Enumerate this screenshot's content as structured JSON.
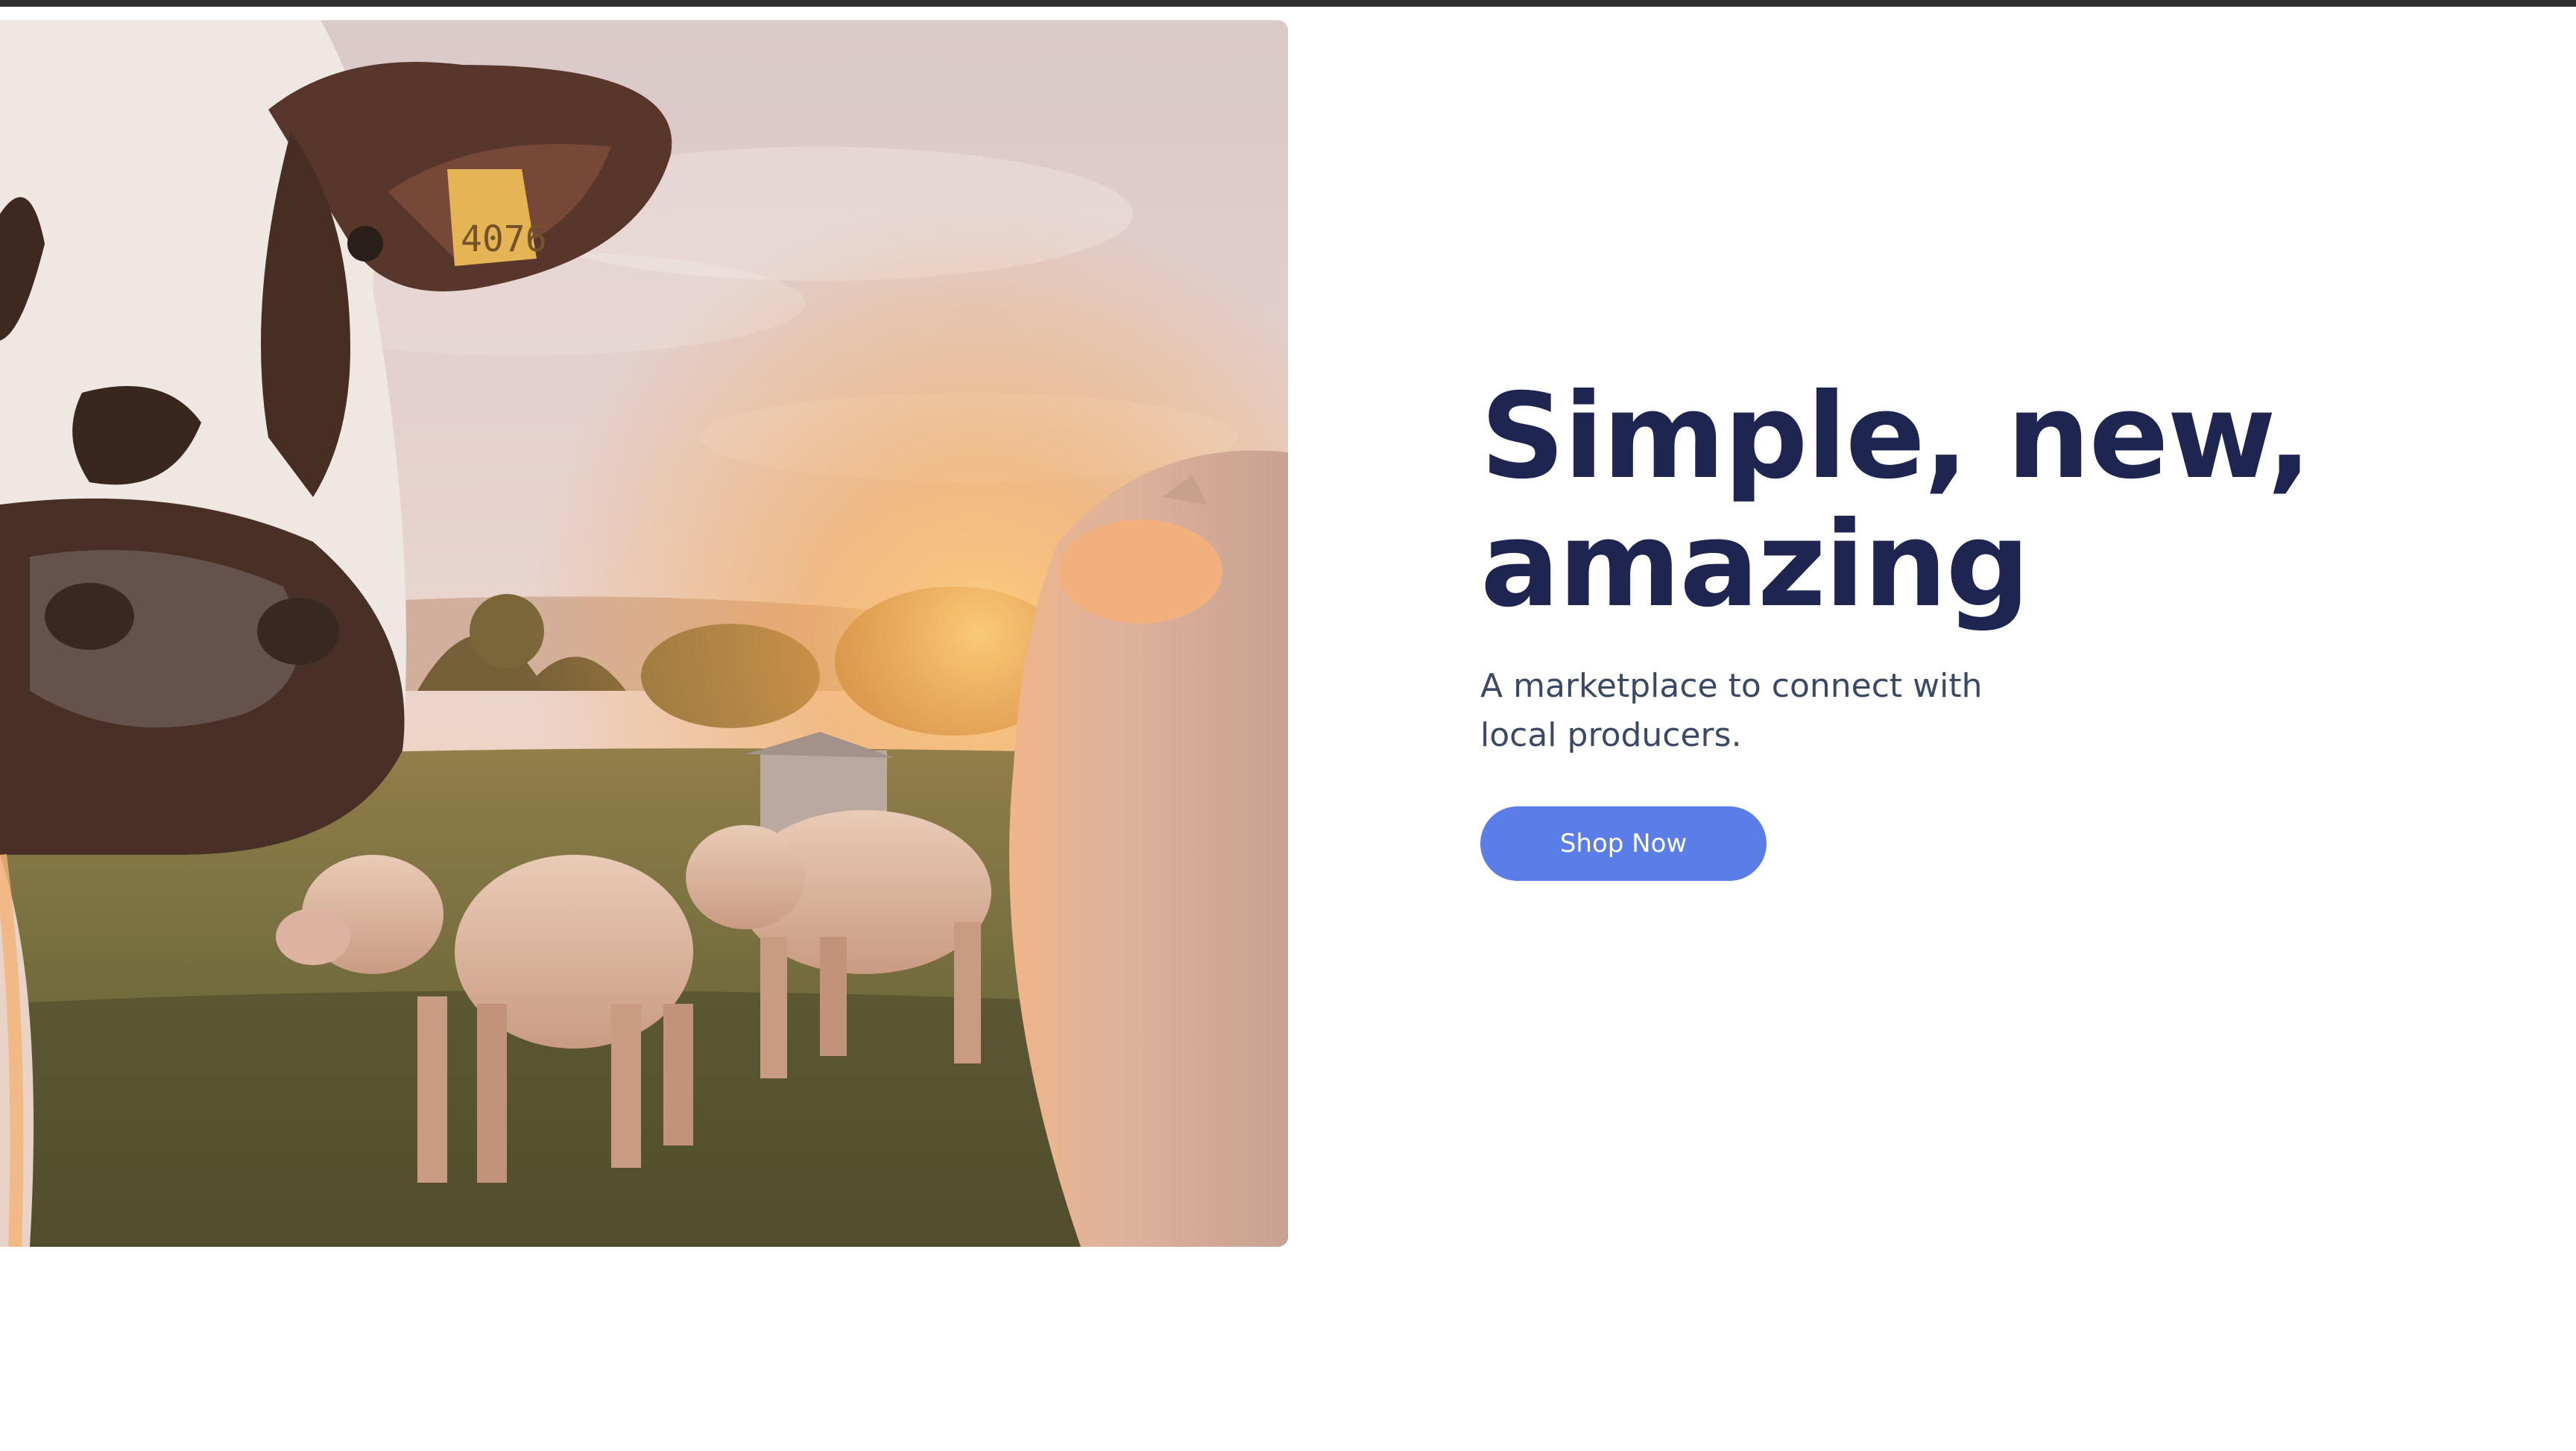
{
  "hero": {
    "image_alt": "Cows and calves in a grassy pasture at sunset",
    "headline_line1": "Simple, new,",
    "headline_line2": "amazing",
    "subtitle": "A marketplace to connect with local producers.",
    "cta_label": "Shop Now"
  },
  "image_detail": {
    "ear_tag_number": "4076"
  },
  "colors": {
    "headline": "#1d2550",
    "subtitle": "#3a4a66",
    "button_bg": "#5b7de8",
    "button_text": "#ffffff",
    "top_bar": "#2f2f31"
  }
}
